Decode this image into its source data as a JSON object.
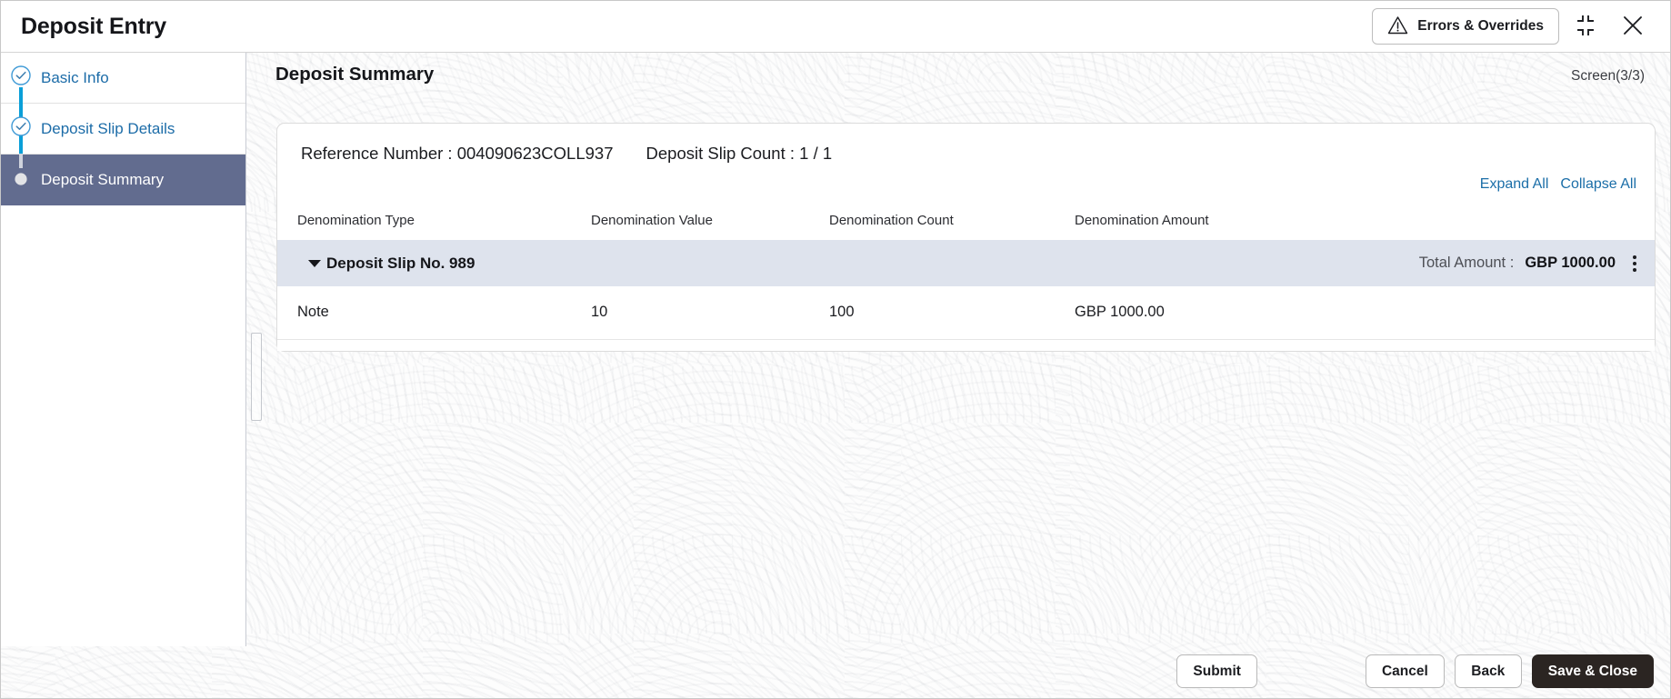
{
  "window": {
    "title": "Deposit Entry",
    "errors_button": "Errors & Overrides",
    "errors_icon": "warning-triangle-icon",
    "minimize_icon": "collapse-corners-icon",
    "close_icon": "close-x-icon"
  },
  "sidebar": {
    "steps": [
      {
        "label": "Basic Info",
        "state": "completed",
        "icon": "check-circle-icon"
      },
      {
        "label": "Deposit Slip Details",
        "state": "completed",
        "icon": "check-circle-icon"
      },
      {
        "label": "Deposit Summary",
        "state": "active",
        "icon": "filled-circle-icon"
      }
    ]
  },
  "main": {
    "section_title": "Deposit Summary",
    "screen_count": "Screen(3/3)",
    "reference_number": "Reference Number : 004090623COLL937",
    "deposit_slip_count": "Deposit Slip Count : 1 / 1",
    "expand_all": "Expand All",
    "collapse_all": "Collapse All",
    "columns": [
      "Denomination Type",
      "Denomination Value",
      "Denomination Count",
      "Denomination Amount"
    ],
    "group": {
      "label": "Deposit Slip No. 989",
      "total_label": "Total Amount :",
      "total_value": "GBP 1000.00",
      "menu_icon": "kebab-menu-icon",
      "expanded": true
    },
    "rows": [
      {
        "denomination_type": "Note",
        "denomination_value": "10",
        "denomination_count": "100",
        "denomination_amount": "GBP 1000.00"
      }
    ]
  },
  "footer": {
    "submit": "Submit",
    "cancel": "Cancel",
    "back": "Back",
    "save_close": "Save & Close"
  },
  "colors": {
    "link": "#1b6ea8",
    "step_active_bg": "#626c8f",
    "connector": "#0a9fd8",
    "group_row_bg": "#dee3ed",
    "primary_button": "#2b2522"
  }
}
